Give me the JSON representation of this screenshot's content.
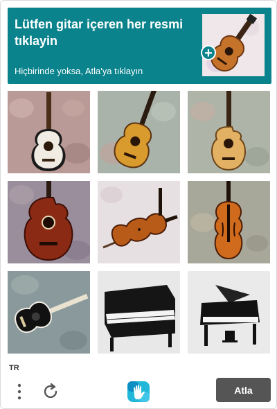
{
  "challenge": {
    "title": "Lütfen gitar içeren her resmi tıklayin",
    "subtitle": "Hiçbirinde yoksa, Atla'ya tıklayın",
    "example_subject": "guitar"
  },
  "tiles": [
    {
      "subject": "acoustic guitar (light top, black body)"
    },
    {
      "subject": "acoustic guitar (sunburst)"
    },
    {
      "subject": "acoustic guitar (natural, cutaway)"
    },
    {
      "subject": "acoustic guitar (dark red, cutaway)"
    },
    {
      "subject": "violin with bow"
    },
    {
      "subject": "violin"
    },
    {
      "subject": "acoustic guitar (black, lying)"
    },
    {
      "subject": "upright piano"
    },
    {
      "subject": "grand piano"
    }
  ],
  "footer": {
    "language": "TR",
    "skip_label": "Atla",
    "menu_icon": "more-vertical-icon",
    "refresh_icon": "refresh-icon",
    "logo_icon": "hcaptcha-logo-icon"
  },
  "colors": {
    "header_bg": "#0a838c",
    "skip_bg": "#555555"
  }
}
